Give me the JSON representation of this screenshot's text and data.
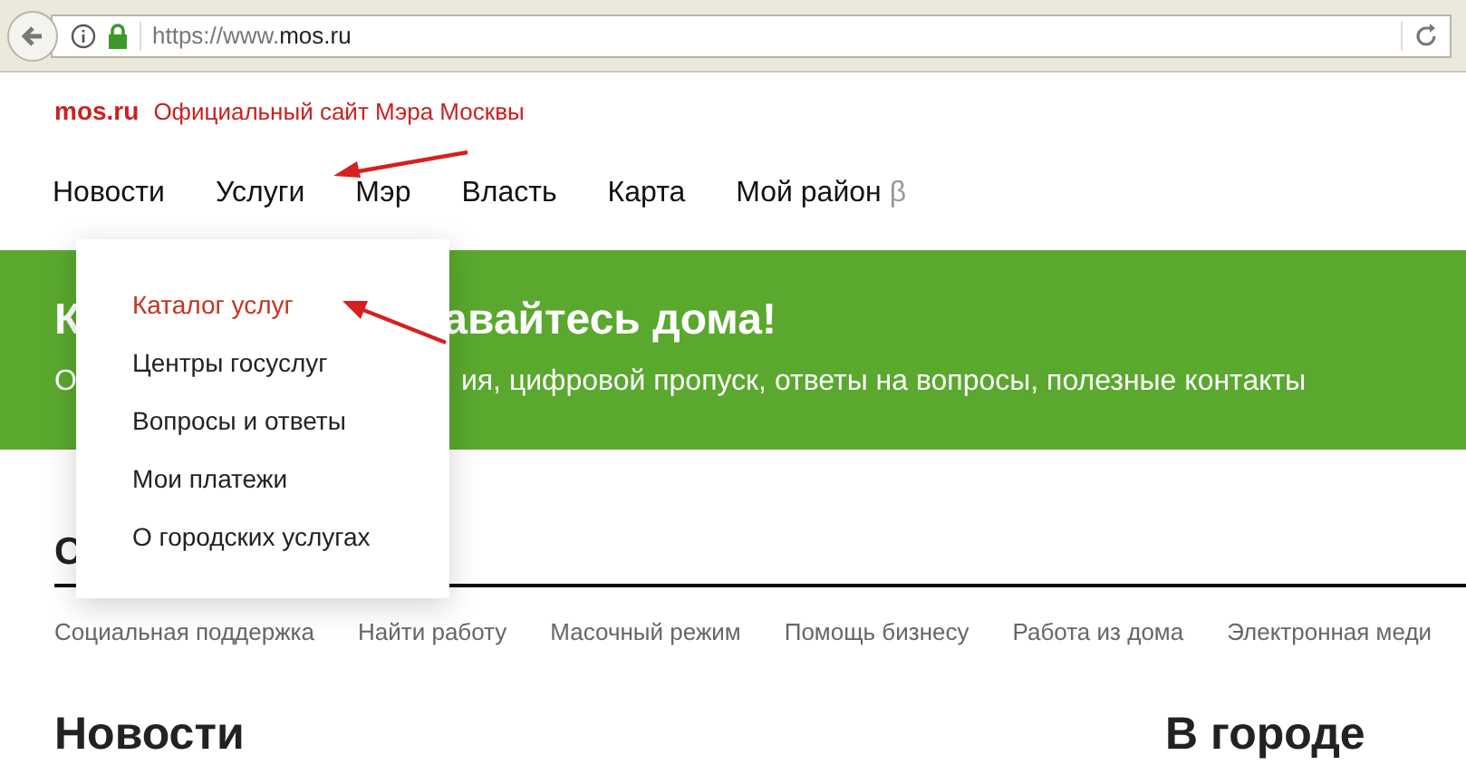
{
  "browser": {
    "url_prefix": "https://www.",
    "url_domain": "mos.ru"
  },
  "header": {
    "logo": "mos.ru",
    "tagline": "Официальный сайт Мэра Москвы"
  },
  "nav": [
    {
      "label": "Новости"
    },
    {
      "label": "Услуги"
    },
    {
      "label": "Мэр"
    },
    {
      "label": "Власть"
    },
    {
      "label": "Карта"
    },
    {
      "label": "Мой район",
      "suffix": "β"
    }
  ],
  "dropdown": [
    {
      "label": "Каталог услуг",
      "selected": true
    },
    {
      "label": "Центры госуслуг",
      "selected": false
    },
    {
      "label": "Вопросы и ответы",
      "selected": false
    },
    {
      "label": "Мои платежи",
      "selected": false
    },
    {
      "label": "О городских услугах",
      "selected": false
    }
  ],
  "banner": {
    "title_start": "К",
    "title_end": "авайтесь дома!",
    "subtitle_start": "О",
    "subtitle_end": "ия, цифровой пропуск, ответы на вопросы, полезные контакты"
  },
  "section": {
    "heading_start": "С"
  },
  "topics": [
    "Социальная поддержка",
    "Найти работу",
    "Масочный режим",
    "Помощь бизнесу",
    "Работа из дома",
    "Электронная меди"
  ],
  "columns": [
    {
      "heading": "Новости"
    },
    {
      "heading": "В городе"
    }
  ]
}
